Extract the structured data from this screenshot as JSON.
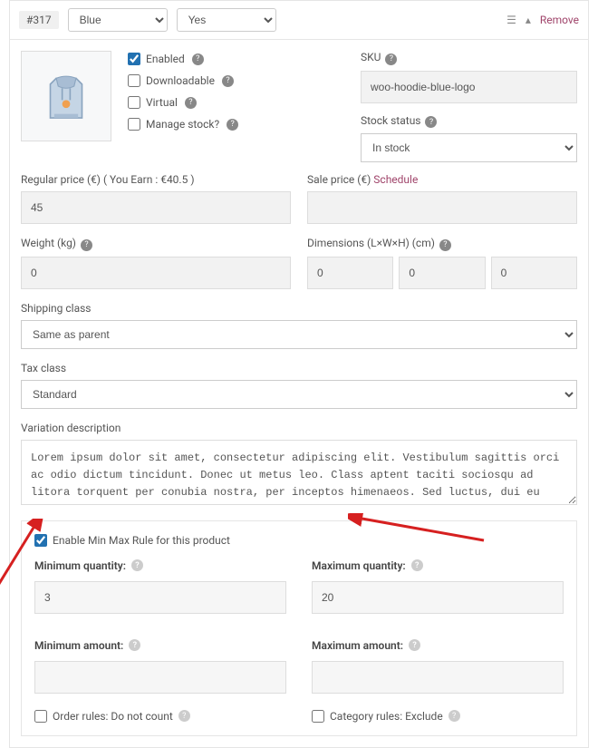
{
  "header": {
    "variationId": "#317",
    "attr1": "Blue",
    "attr2": "Yes",
    "remove": "Remove"
  },
  "checks": {
    "enabled": {
      "label": "Enabled",
      "checked": true
    },
    "downloadable": {
      "label": "Downloadable",
      "checked": false
    },
    "virtual": {
      "label": "Virtual",
      "checked": false
    },
    "manageStock": {
      "label": "Manage stock?",
      "checked": false
    }
  },
  "sku": {
    "label": "SKU",
    "value": "woo-hoodie-blue-logo"
  },
  "stock": {
    "label": "Stock status",
    "value": "In stock"
  },
  "regularPrice": {
    "label": "Regular price (€) ( You Earn : €40.5 )",
    "value": "45"
  },
  "salePrice": {
    "label": "Sale price (€)",
    "schedule": "Schedule",
    "value": ""
  },
  "weight": {
    "label": "Weight (kg)",
    "value": "0"
  },
  "dimensions": {
    "label": "Dimensions (L×W×H) (cm)",
    "l": "0",
    "w": "0",
    "h": "0"
  },
  "shippingClass": {
    "label": "Shipping class",
    "value": "Same as parent"
  },
  "taxClass": {
    "label": "Tax class",
    "value": "Standard"
  },
  "description": {
    "label": "Variation description",
    "value": "Lorem ipsum dolor sit amet, consectetur adipiscing elit. Vestibulum sagittis orci ac odio dictum tincidunt. Donec ut metus leo. Class aptent taciti sociosqu ad litora torquent per conubia nostra, per inceptos himenaeos. Sed luctus, dui eu sagittis sodales, nulla nibh sagittis augue, vel porttitor diam enim non metus. Vestibulum aliquam augue neque. Phasellus tincidunt odio eget ullamcorper efficitur. Cras placerat ut"
  },
  "minmax": {
    "enable": {
      "label": "Enable Min Max Rule for this product",
      "checked": true
    },
    "minQty": {
      "label": "Minimum quantity:",
      "value": "3"
    },
    "maxQty": {
      "label": "Maximum quantity:",
      "value": "20"
    },
    "minAmt": {
      "label": "Minimum amount:",
      "value": ""
    },
    "maxAmt": {
      "label": "Maximum amount:",
      "value": ""
    },
    "orderRules": {
      "label": "Order rules: Do not count",
      "checked": false
    },
    "categoryRules": {
      "label": "Category rules: Exclude",
      "checked": false
    }
  }
}
